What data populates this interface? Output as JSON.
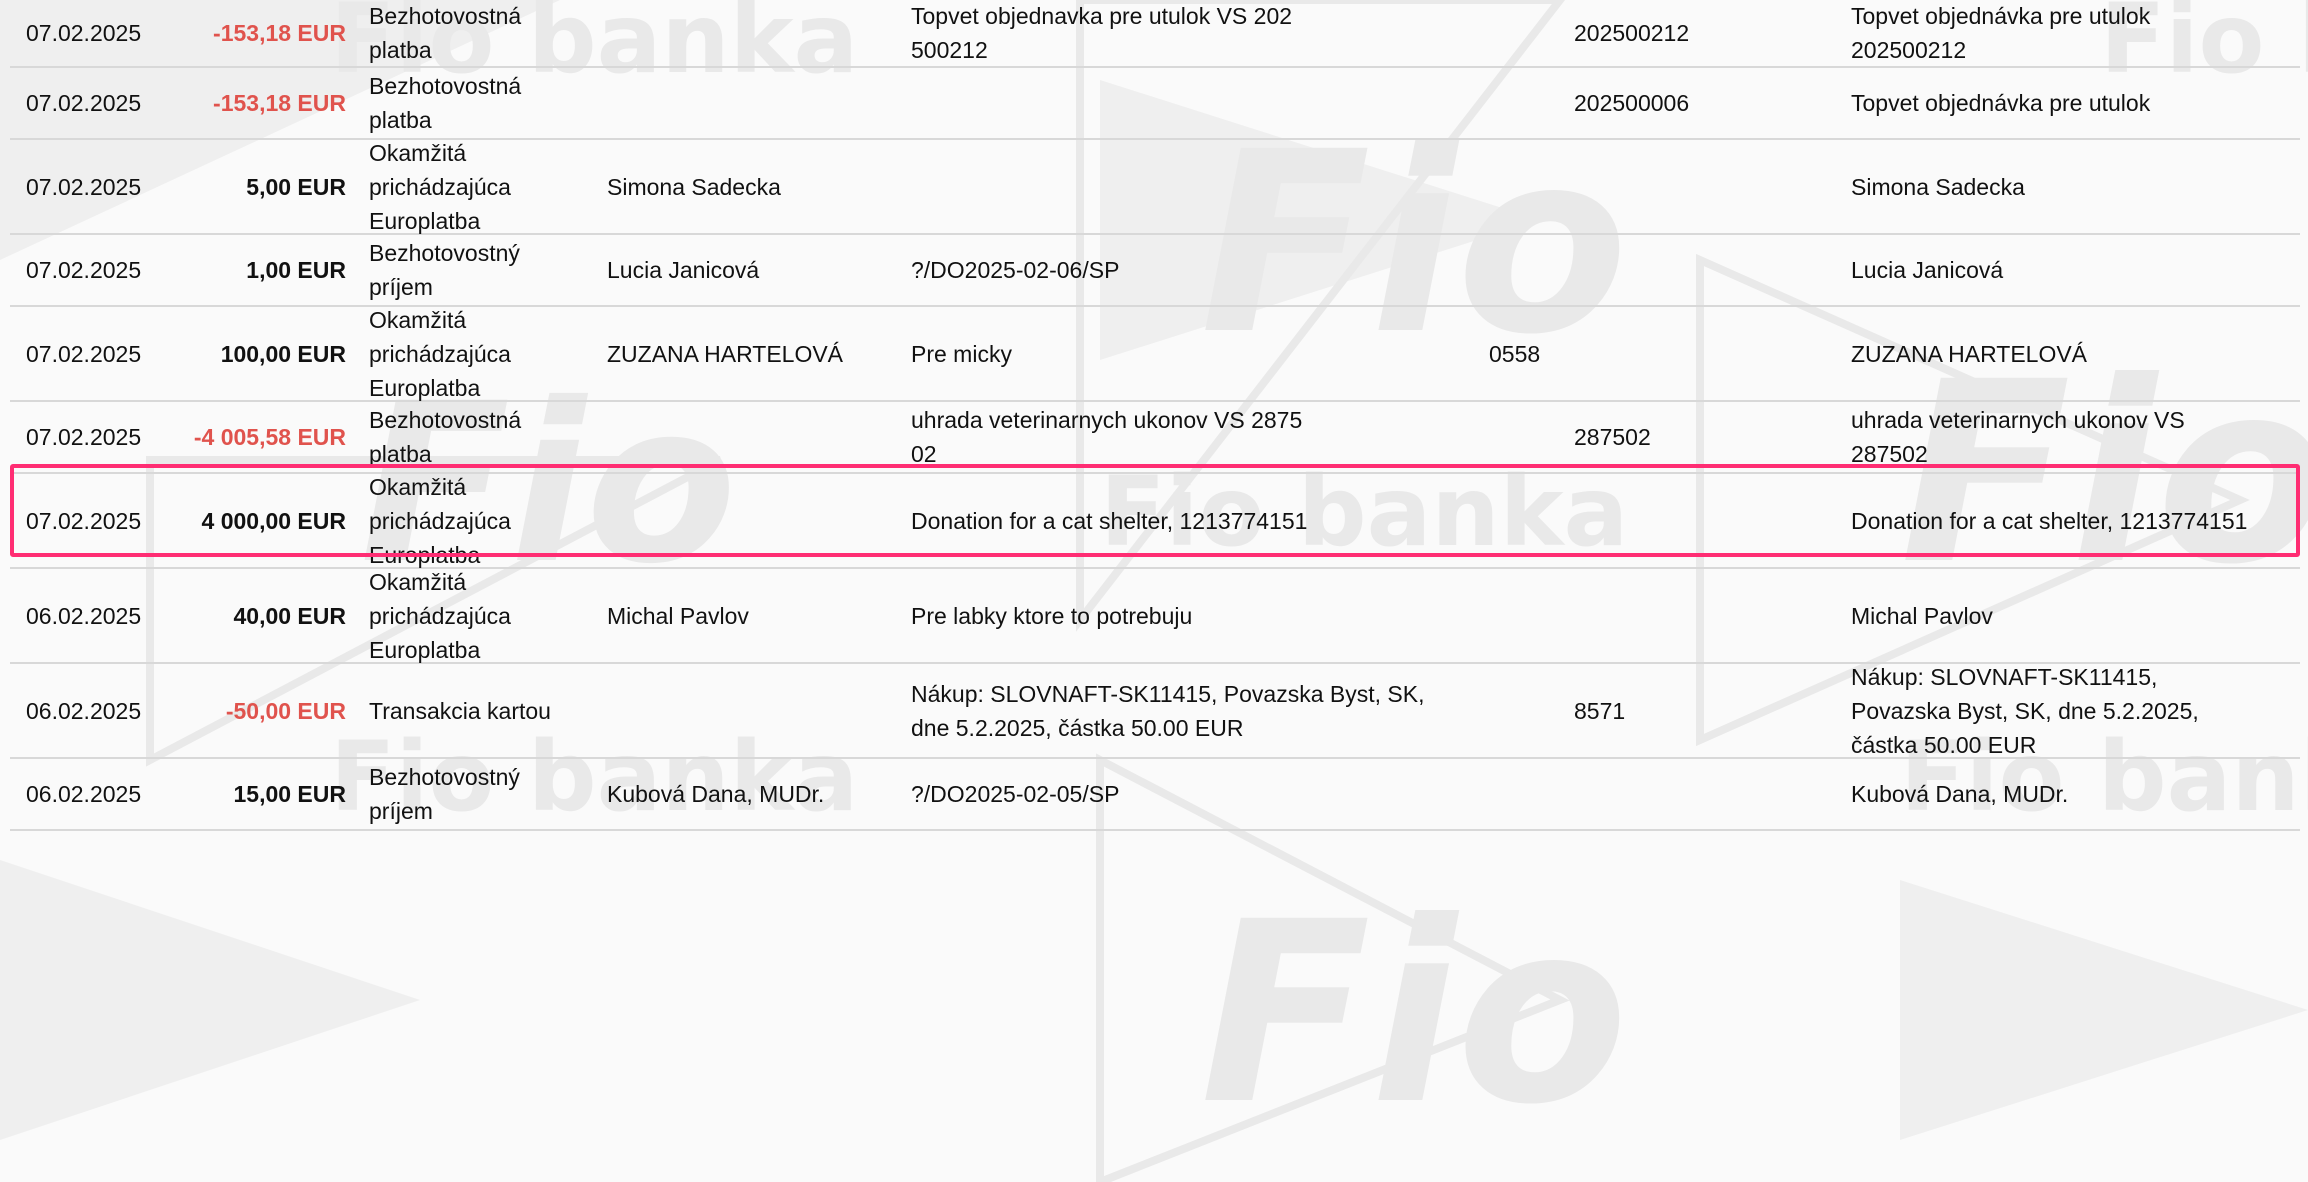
{
  "watermark": {
    "brand_text": "Fio banka",
    "logo_text": "Fio"
  },
  "colors": {
    "negative": "#e0534d",
    "highlight": "#ff2d73",
    "divider": "#d8d8d8"
  },
  "transactions": [
    {
      "date": "07.02.2025",
      "amount": "-153,18 EUR",
      "negative": true,
      "type": [
        "Bezhotovostná",
        "platba"
      ],
      "party": "",
      "message": [
        "Topvet objednavka pre utulok VS 202",
        "500212"
      ],
      "ks": "",
      "vs": "202500212",
      "note": [
        "Topvet objednávka pre utulok",
        "202500212"
      ]
    },
    {
      "date": "07.02.2025",
      "amount": "-153,18 EUR",
      "negative": true,
      "type": [
        "Bezhotovostná",
        "platba"
      ],
      "party": "",
      "message": [],
      "ks": "",
      "vs": "202500006",
      "note": [
        "Topvet objednávka pre utulok"
      ]
    },
    {
      "date": "07.02.2025",
      "amount": "5,00 EUR",
      "negative": false,
      "type": [
        "Okamžitá",
        "prichádzajúca",
        "Europlatba"
      ],
      "party": "Simona Sadecka",
      "message": [],
      "ks": "",
      "vs": "",
      "note": [
        "Simona Sadecka"
      ]
    },
    {
      "date": "07.02.2025",
      "amount": "1,00 EUR",
      "negative": false,
      "type": [
        "Bezhotovostný",
        "príjem"
      ],
      "party": "Lucia Janicová",
      "message": [
        "?/DO2025-02-06/SP"
      ],
      "ks": "",
      "vs": "",
      "note": [
        "Lucia Janicová"
      ]
    },
    {
      "date": "07.02.2025",
      "amount": "100,00 EUR",
      "negative": false,
      "type": [
        "Okamžitá",
        "prichádzajúca",
        "Europlatba"
      ],
      "party": "ZUZANA HARTELOVÁ",
      "message": [
        "Pre micky"
      ],
      "ks": "0558",
      "vs": "",
      "note": [
        "ZUZANA HARTELOVÁ"
      ]
    },
    {
      "date": "07.02.2025",
      "amount": "-4 005,58 EUR",
      "negative": true,
      "type": [
        "Bezhotovostná",
        "platba"
      ],
      "party": "",
      "message": [
        "uhrada veterinarnych ukonov VS 2875",
        "02"
      ],
      "ks": "",
      "vs": "287502",
      "note": [
        "uhrada veterinarnych ukonov VS",
        "287502"
      ]
    },
    {
      "date": "07.02.2025",
      "amount": "4 000,00 EUR",
      "negative": false,
      "type": [
        "Okamžitá",
        "prichádzajúca",
        "Europlatba"
      ],
      "party": "",
      "message": [
        "Donation for a cat shelter, 1213774151"
      ],
      "ks": "",
      "vs": "",
      "note": [
        "Donation for a cat shelter, 1213774151"
      ]
    },
    {
      "date": "06.02.2025",
      "amount": "40,00 EUR",
      "negative": false,
      "type": [
        "Okamžitá",
        "prichádzajúca",
        "Europlatba"
      ],
      "party": "Michal Pavlov",
      "message": [
        "Pre labky ktore to potrebuju"
      ],
      "ks": "",
      "vs": "",
      "note": [
        "Michal Pavlov"
      ]
    },
    {
      "date": "06.02.2025",
      "amount": "-50,00 EUR",
      "negative": true,
      "type": [
        "Transakcia kartou"
      ],
      "party": "",
      "message": [
        "Nákup: SLOVNAFT-SK11415, Povazska Byst, SK,",
        "dne 5.2.2025, částka 50.00 EUR"
      ],
      "ks": "",
      "vs": "8571",
      "note": [
        "Nákup: SLOVNAFT-SK11415,",
        "Povazska Byst, SK, dne 5.2.2025,",
        "částka 50.00 EUR"
      ]
    },
    {
      "date": "06.02.2025",
      "amount": "15,00 EUR",
      "negative": false,
      "type": [
        "Bezhotovostný",
        "príjem"
      ],
      "party": "Kubová Dana, MUDr.",
      "message": [
        "?/DO2025-02-05/SP"
      ],
      "ks": "",
      "vs": "",
      "note": [
        "Kubová Dana, MUDr."
      ]
    }
  ]
}
